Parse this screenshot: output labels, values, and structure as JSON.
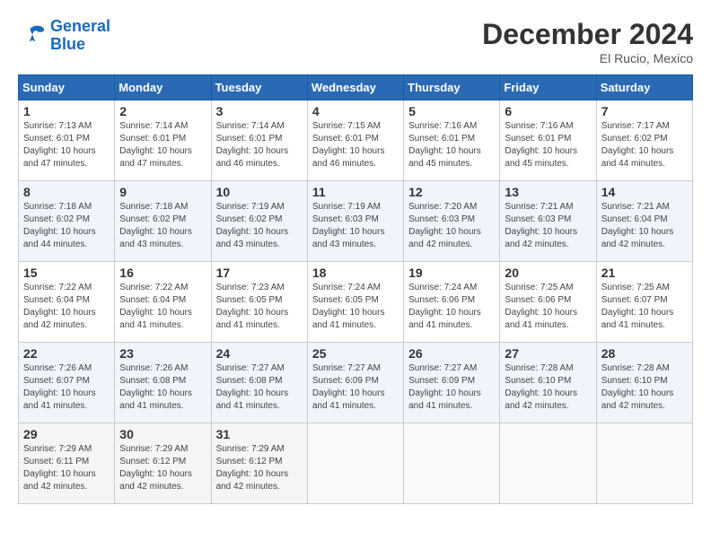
{
  "logo": {
    "line1": "General",
    "line2": "Blue"
  },
  "title": "December 2024",
  "subtitle": "El Rucio, Mexico",
  "weekdays": [
    "Sunday",
    "Monday",
    "Tuesday",
    "Wednesday",
    "Thursday",
    "Friday",
    "Saturday"
  ],
  "weeks": [
    [
      {
        "day": "1",
        "info": "Sunrise: 7:13 AM\nSunset: 6:01 PM\nDaylight: 10 hours and 47 minutes."
      },
      {
        "day": "2",
        "info": "Sunrise: 7:14 AM\nSunset: 6:01 PM\nDaylight: 10 hours and 47 minutes."
      },
      {
        "day": "3",
        "info": "Sunrise: 7:14 AM\nSunset: 6:01 PM\nDaylight: 10 hours and 46 minutes."
      },
      {
        "day": "4",
        "info": "Sunrise: 7:15 AM\nSunset: 6:01 PM\nDaylight: 10 hours and 46 minutes."
      },
      {
        "day": "5",
        "info": "Sunrise: 7:16 AM\nSunset: 6:01 PM\nDaylight: 10 hours and 45 minutes."
      },
      {
        "day": "6",
        "info": "Sunrise: 7:16 AM\nSunset: 6:01 PM\nDaylight: 10 hours and 45 minutes."
      },
      {
        "day": "7",
        "info": "Sunrise: 7:17 AM\nSunset: 6:02 PM\nDaylight: 10 hours and 44 minutes."
      }
    ],
    [
      {
        "day": "8",
        "info": "Sunrise: 7:18 AM\nSunset: 6:02 PM\nDaylight: 10 hours and 44 minutes."
      },
      {
        "day": "9",
        "info": "Sunrise: 7:18 AM\nSunset: 6:02 PM\nDaylight: 10 hours and 43 minutes."
      },
      {
        "day": "10",
        "info": "Sunrise: 7:19 AM\nSunset: 6:02 PM\nDaylight: 10 hours and 43 minutes."
      },
      {
        "day": "11",
        "info": "Sunrise: 7:19 AM\nSunset: 6:03 PM\nDaylight: 10 hours and 43 minutes."
      },
      {
        "day": "12",
        "info": "Sunrise: 7:20 AM\nSunset: 6:03 PM\nDaylight: 10 hours and 42 minutes."
      },
      {
        "day": "13",
        "info": "Sunrise: 7:21 AM\nSunset: 6:03 PM\nDaylight: 10 hours and 42 minutes."
      },
      {
        "day": "14",
        "info": "Sunrise: 7:21 AM\nSunset: 6:04 PM\nDaylight: 10 hours and 42 minutes."
      }
    ],
    [
      {
        "day": "15",
        "info": "Sunrise: 7:22 AM\nSunset: 6:04 PM\nDaylight: 10 hours and 42 minutes."
      },
      {
        "day": "16",
        "info": "Sunrise: 7:22 AM\nSunset: 6:04 PM\nDaylight: 10 hours and 41 minutes."
      },
      {
        "day": "17",
        "info": "Sunrise: 7:23 AM\nSunset: 6:05 PM\nDaylight: 10 hours and 41 minutes."
      },
      {
        "day": "18",
        "info": "Sunrise: 7:24 AM\nSunset: 6:05 PM\nDaylight: 10 hours and 41 minutes."
      },
      {
        "day": "19",
        "info": "Sunrise: 7:24 AM\nSunset: 6:06 PM\nDaylight: 10 hours and 41 minutes."
      },
      {
        "day": "20",
        "info": "Sunrise: 7:25 AM\nSunset: 6:06 PM\nDaylight: 10 hours and 41 minutes."
      },
      {
        "day": "21",
        "info": "Sunrise: 7:25 AM\nSunset: 6:07 PM\nDaylight: 10 hours and 41 minutes."
      }
    ],
    [
      {
        "day": "22",
        "info": "Sunrise: 7:26 AM\nSunset: 6:07 PM\nDaylight: 10 hours and 41 minutes."
      },
      {
        "day": "23",
        "info": "Sunrise: 7:26 AM\nSunset: 6:08 PM\nDaylight: 10 hours and 41 minutes."
      },
      {
        "day": "24",
        "info": "Sunrise: 7:27 AM\nSunset: 6:08 PM\nDaylight: 10 hours and 41 minutes."
      },
      {
        "day": "25",
        "info": "Sunrise: 7:27 AM\nSunset: 6:09 PM\nDaylight: 10 hours and 41 minutes."
      },
      {
        "day": "26",
        "info": "Sunrise: 7:27 AM\nSunset: 6:09 PM\nDaylight: 10 hours and 41 minutes."
      },
      {
        "day": "27",
        "info": "Sunrise: 7:28 AM\nSunset: 6:10 PM\nDaylight: 10 hours and 42 minutes."
      },
      {
        "day": "28",
        "info": "Sunrise: 7:28 AM\nSunset: 6:10 PM\nDaylight: 10 hours and 42 minutes."
      }
    ],
    [
      {
        "day": "29",
        "info": "Sunrise: 7:29 AM\nSunset: 6:11 PM\nDaylight: 10 hours and 42 minutes."
      },
      {
        "day": "30",
        "info": "Sunrise: 7:29 AM\nSunset: 6:12 PM\nDaylight: 10 hours and 42 minutes."
      },
      {
        "day": "31",
        "info": "Sunrise: 7:29 AM\nSunset: 6:12 PM\nDaylight: 10 hours and 42 minutes."
      },
      null,
      null,
      null,
      null
    ]
  ]
}
